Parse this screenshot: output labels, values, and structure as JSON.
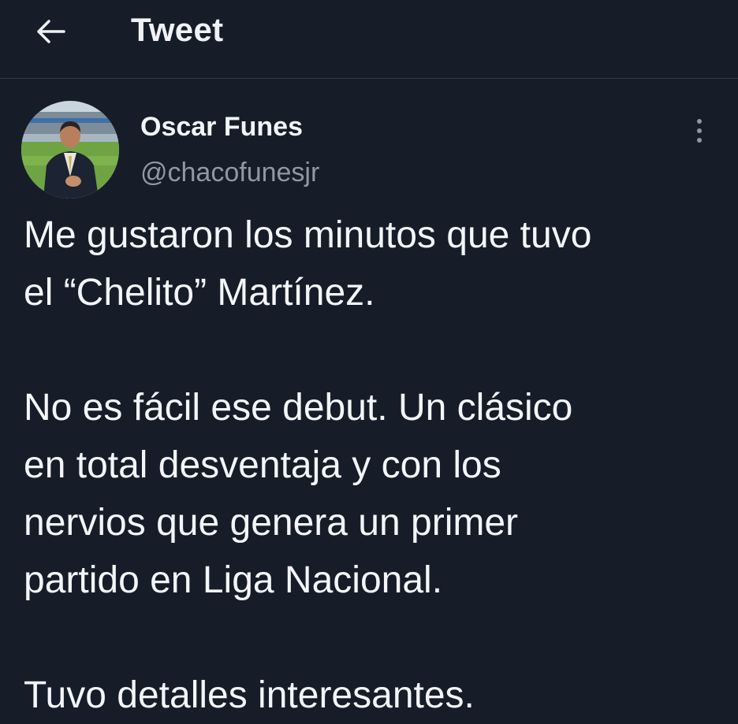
{
  "header": {
    "back_icon": "arrow-left-icon",
    "title": "Tweet"
  },
  "author": {
    "name": "Oscar Funes",
    "handle": "@chacofunesjr",
    "avatar_icon": "profile-photo"
  },
  "more_icon": "more-vertical-icon",
  "tweet": {
    "lines": [
      "Me gustaron los minutos que tuvo",
      "el “Chelito” Martínez.",
      "",
      "No es fácil ese debut. Un clásico",
      "en total desventaja y con los",
      "nervios que genera un primer",
      "partido en Liga Nacional.",
      "",
      "Tuvo detalles interesantes."
    ]
  },
  "colors": {
    "background": "#161d29",
    "text_primary": "#f3f5f8",
    "text_secondary": "#8f98a3",
    "divider": "#323a46"
  }
}
